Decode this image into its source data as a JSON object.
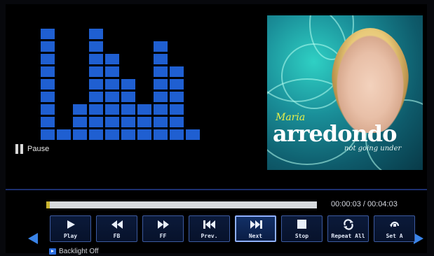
{
  "equalizer": {
    "levels": [
      9,
      1,
      3,
      9,
      7,
      5,
      3,
      8,
      6,
      1
    ]
  },
  "status": {
    "label": "Pause",
    "icon": "pause-icon"
  },
  "album_art": {
    "artist_first": "Maria",
    "artist_last": "arredondo",
    "album_title": "not going under"
  },
  "progress": {
    "elapsed": "00:00:03",
    "separator": " / ",
    "total": "00:04:03",
    "fraction": 0.012
  },
  "controls": [
    {
      "name": "play",
      "label": "Play",
      "icon": "play-icon"
    },
    {
      "name": "fb",
      "label": "FB",
      "icon": "fast-backward-icon"
    },
    {
      "name": "ff",
      "label": "FF",
      "icon": "fast-forward-icon"
    },
    {
      "name": "prev",
      "label": "Prev.",
      "icon": "previous-icon"
    },
    {
      "name": "next",
      "label": "Next",
      "icon": "next-icon",
      "selected": true
    },
    {
      "name": "stop",
      "label": "Stop",
      "icon": "stop-icon"
    },
    {
      "name": "repeat-all",
      "label": "Repeat All",
      "icon": "repeat-icon"
    },
    {
      "name": "set-a",
      "label": "Set A",
      "icon": "set-a-icon"
    }
  ],
  "backlight": {
    "label": "Backlight Off"
  },
  "colors": {
    "eq_bar": "#1f5fd1",
    "accent": "#3a84e8",
    "progress_fill": "#c9b430"
  }
}
